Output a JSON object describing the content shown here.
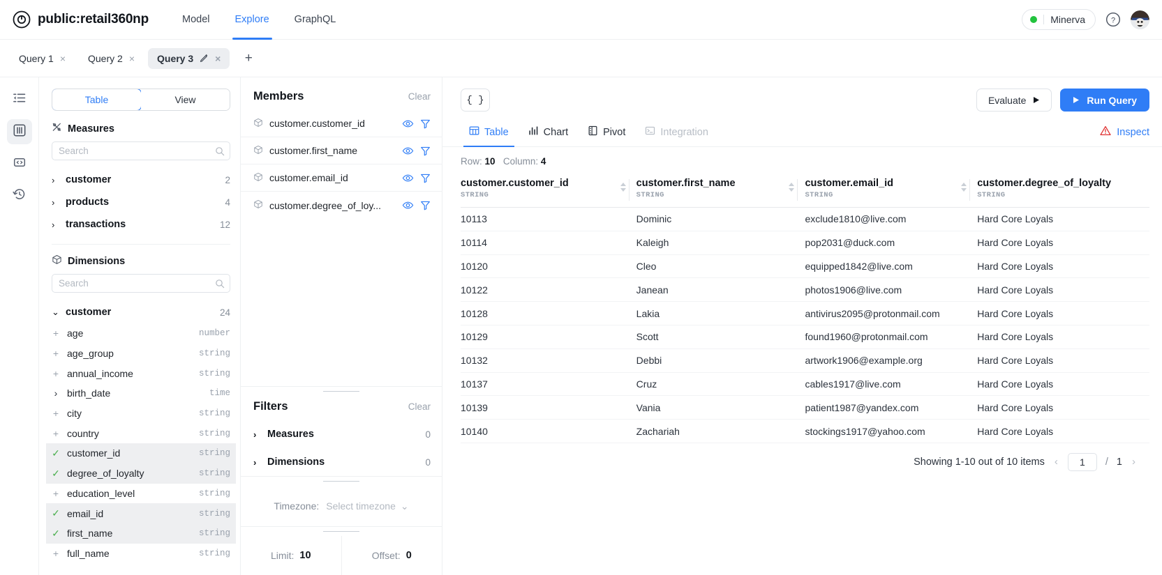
{
  "header": {
    "brand_title": "public:retail360np",
    "logo_icon": "target-circle-icon",
    "nav": [
      {
        "label": "Model",
        "active": false
      },
      {
        "label": "Explore",
        "active": true
      },
      {
        "label": "GraphQL",
        "active": false
      }
    ],
    "env_label": "Minerva",
    "env_dot_color": "#22c33e",
    "help_icon": "question-circle-icon",
    "avatar_icon": "user-avatar"
  },
  "query_tabs": {
    "tabs": [
      {
        "label": "Query 1",
        "active": false,
        "has_pen": false
      },
      {
        "label": "Query 2",
        "active": false,
        "has_pen": false
      },
      {
        "label": "Query 3",
        "active": true,
        "has_pen": true
      }
    ],
    "add_label": "+",
    "close_glyph": "×",
    "pen_glyph": "✎"
  },
  "rail": {
    "items": [
      {
        "icon": "collapse-sidebar-icon",
        "active": false
      },
      {
        "icon": "data-model-icon",
        "active": true
      },
      {
        "icon": "code-brackets-icon",
        "active": false
      },
      {
        "icon": "history-clock-icon",
        "active": false
      }
    ]
  },
  "left_panel": {
    "segmented": [
      {
        "label": "Table",
        "active": true
      },
      {
        "label": "View",
        "active": false
      }
    ],
    "measures": {
      "title": "Measures",
      "icon": "measures-icon",
      "search_placeholder": "Search",
      "search_value": "",
      "cubes": [
        {
          "name": "customer",
          "count": "2",
          "expanded": false
        },
        {
          "name": "products",
          "count": "4",
          "expanded": false
        },
        {
          "name": "transactions",
          "count": "12",
          "expanded": false
        }
      ]
    },
    "dimensions": {
      "title": "Dimensions",
      "icon": "cube-icon",
      "search_placeholder": "Search",
      "search_value": "",
      "cube": {
        "name": "customer",
        "count": "24",
        "expanded": true
      },
      "fields": [
        {
          "name": "age",
          "type": "number",
          "state": "add"
        },
        {
          "name": "age_group",
          "type": "string",
          "state": "add"
        },
        {
          "name": "annual_income",
          "type": "string",
          "state": "add"
        },
        {
          "name": "birth_date",
          "type": "time",
          "state": "expand"
        },
        {
          "name": "city",
          "type": "string",
          "state": "add"
        },
        {
          "name": "country",
          "type": "string",
          "state": "add"
        },
        {
          "name": "customer_id",
          "type": "string",
          "state": "selected"
        },
        {
          "name": "degree_of_loyalty",
          "type": "string",
          "state": "selected"
        },
        {
          "name": "education_level",
          "type": "string",
          "state": "add"
        },
        {
          "name": "email_id",
          "type": "string",
          "state": "selected"
        },
        {
          "name": "first_name",
          "type": "string",
          "state": "selected"
        },
        {
          "name": "full_name",
          "type": "string",
          "state": "add"
        }
      ]
    }
  },
  "members_panel": {
    "title": "Members",
    "clear_label": "Clear",
    "items": [
      {
        "name": "customer.customer_id",
        "icon": "cube-icon",
        "eye_icon": "eye-icon",
        "filter_icon": "filter-icon"
      },
      {
        "name": "customer.first_name",
        "icon": "cube-icon",
        "eye_icon": "eye-icon",
        "filter_icon": "filter-icon"
      },
      {
        "name": "customer.email_id",
        "icon": "cube-icon",
        "eye_icon": "eye-icon",
        "filter_icon": "filter-icon"
      },
      {
        "name": "customer.degree_of_loy...",
        "icon": "cube-icon",
        "eye_icon": "eye-icon",
        "filter_icon": "filter-icon"
      }
    ],
    "filters": {
      "title": "Filters",
      "clear_label": "Clear",
      "groups": [
        {
          "label": "Measures",
          "count": "0"
        },
        {
          "label": "Dimensions",
          "count": "0"
        }
      ]
    },
    "timezone": {
      "label": "Timezone:",
      "value": "Select timezone"
    },
    "limit": {
      "label": "Limit:",
      "value": "10"
    },
    "offset": {
      "label": "Offset:",
      "value": "0"
    }
  },
  "main": {
    "json_button": "{ }",
    "evaluate_label": "Evaluate",
    "run_label": "Run Query",
    "view_tabs": [
      {
        "label": "Table",
        "icon": "table-icon",
        "active": true,
        "disabled": false
      },
      {
        "label": "Chart",
        "icon": "chart-bar-icon",
        "active": false,
        "disabled": false
      },
      {
        "label": "Pivot",
        "icon": "pivot-icon",
        "active": false,
        "disabled": false
      },
      {
        "label": "Integration",
        "icon": "terminal-icon",
        "active": false,
        "disabled": true
      }
    ],
    "inspect_label": "Inspect",
    "inspect_icon": "warning-triangle-icon",
    "row_label": "Row:",
    "row_count": "10",
    "column_label": "Column:",
    "column_count": "4",
    "columns": [
      {
        "name": "customer.customer_id",
        "type": "STRING"
      },
      {
        "name": "customer.first_name",
        "type": "STRING"
      },
      {
        "name": "customer.email_id",
        "type": "STRING"
      },
      {
        "name": "customer.degree_of_loyalty",
        "type": "STRING"
      }
    ],
    "rows": [
      [
        "10113",
        "Dominic",
        "exclude1810@live.com",
        "Hard Core Loyals"
      ],
      [
        "10114",
        "Kaleigh",
        "pop2031@duck.com",
        "Hard Core Loyals"
      ],
      [
        "10120",
        "Cleo",
        "equipped1842@live.com",
        "Hard Core Loyals"
      ],
      [
        "10122",
        "Janean",
        "photos1906@live.com",
        "Hard Core Loyals"
      ],
      [
        "10128",
        "Lakia",
        "antivirus2095@protonmail.com",
        "Hard Core Loyals"
      ],
      [
        "10129",
        "Scott",
        "found1960@protonmail.com",
        "Hard Core Loyals"
      ],
      [
        "10132",
        "Debbi",
        "artwork1906@example.org",
        "Hard Core Loyals"
      ],
      [
        "10137",
        "Cruz",
        "cables1917@live.com",
        "Hard Core Loyals"
      ],
      [
        "10139",
        "Vania",
        "patient1987@yandex.com",
        "Hard Core Loyals"
      ],
      [
        "10140",
        "Zachariah",
        "stockings1917@yahoo.com",
        "Hard Core Loyals"
      ]
    ],
    "pager": {
      "showing": "Showing 1-10 out of 10 items",
      "current_page": "1",
      "separator": "/",
      "total_pages": "1",
      "prev_glyph": "‹",
      "next_glyph": "›"
    }
  },
  "colors": {
    "accent": "#2f7df6",
    "success": "#22c33e",
    "danger": "#e03131",
    "check": "#4caf50"
  }
}
